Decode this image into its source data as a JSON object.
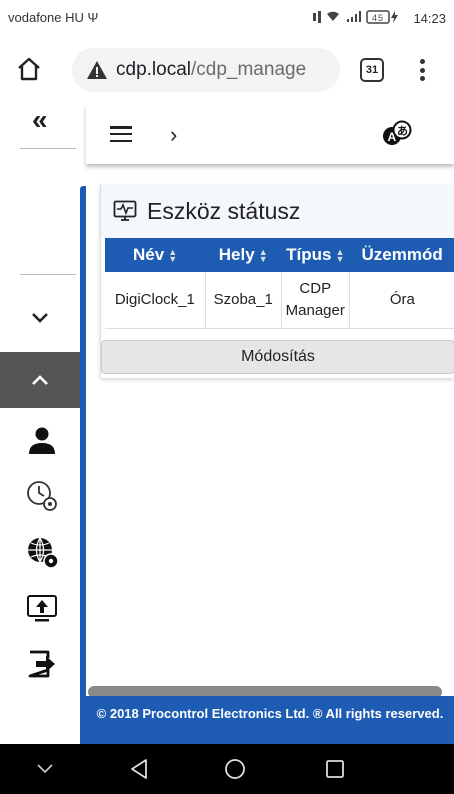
{
  "status_bar": {
    "carrier": "vodafone HU Ψ",
    "icons_text": "▐▐Ω ≡ .∥| 45",
    "battery": "45",
    "time": "14:23"
  },
  "browser": {
    "url_host": "cdp.local",
    "url_path": "/cdp_manage",
    "tab_count": "31"
  },
  "app": {
    "collapse_glyph": "«",
    "breadcrumb_arrow": "›",
    "panel_title": "Eszköz státusz",
    "table": {
      "headers": [
        "Név",
        "Hely",
        "Típus",
        "Üzemmód"
      ],
      "rows": [
        [
          "DigiClock_1",
          "Szoba_1",
          "CDP Manager",
          "Óra"
        ]
      ]
    },
    "modify_label": "Módosítás",
    "footer": "© 2018 Procontrol Electronics Ltd. ® All rights reserved."
  },
  "icons": [
    "home-icon",
    "warning-icon",
    "tabs-icon",
    "more-vert-icon",
    "hamburger-icon",
    "language-icon",
    "monitor-icon",
    "user-icon",
    "clock-settings-icon",
    "globe-settings-icon",
    "upload-icon",
    "logout-icon",
    "back-icon",
    "home-circle-icon",
    "recents-icon"
  ],
  "colors": {
    "accent": "#1e5cb3",
    "dark_button": "#555555"
  }
}
